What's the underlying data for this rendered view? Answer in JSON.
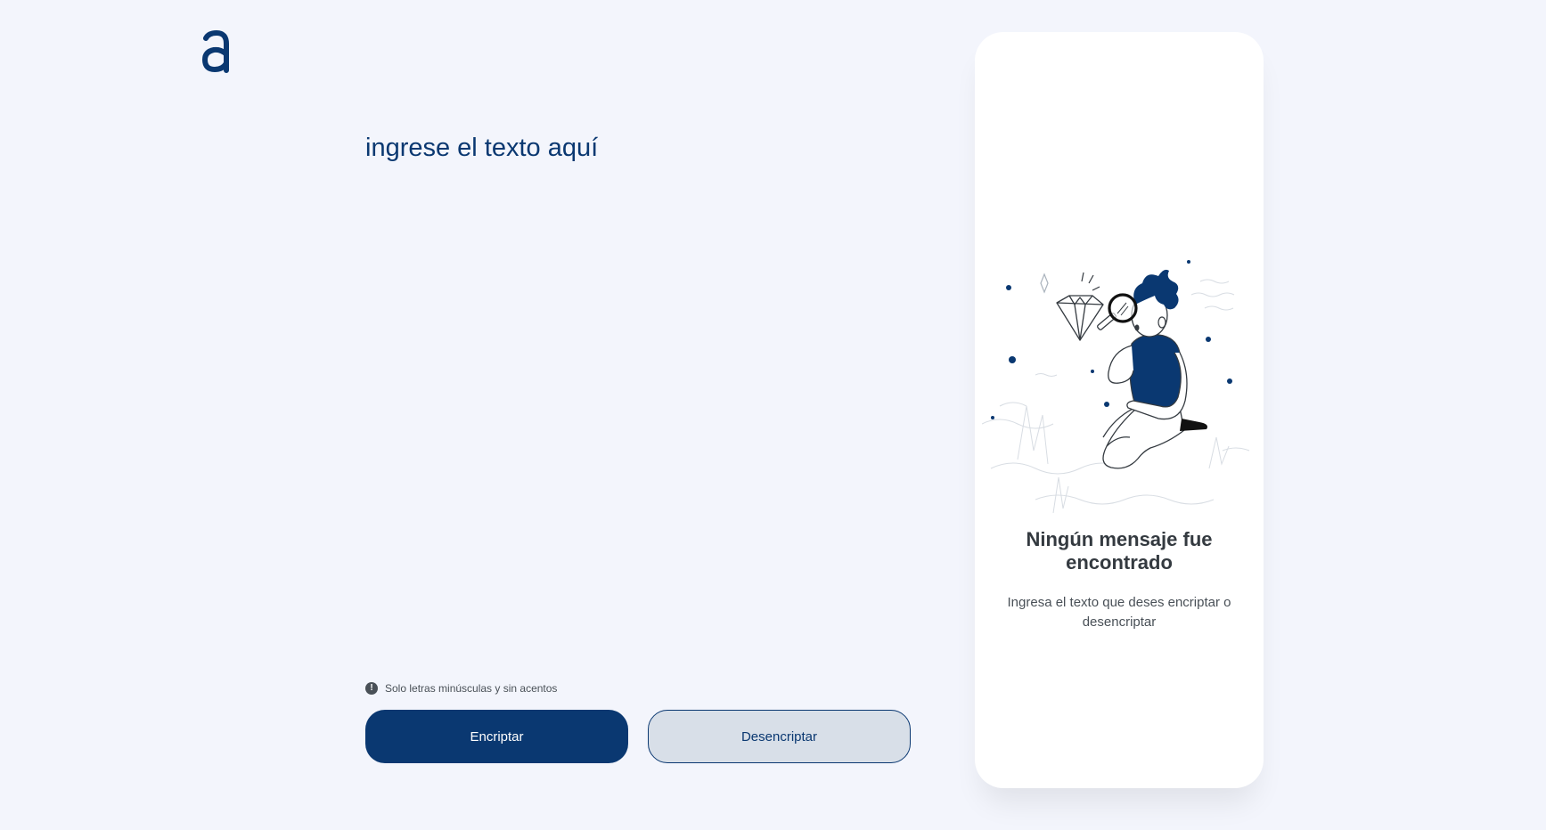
{
  "brand": {
    "logo_icon": "alura-a-logo-icon",
    "color": "#0a3871"
  },
  "input": {
    "placeholder": "ingrese el texto aquí",
    "value": ""
  },
  "hint": {
    "icon": "exclamation-circle-icon",
    "text": "Solo letras minúsculas y sin acentos"
  },
  "buttons": {
    "encrypt_label": "Encriptar",
    "decrypt_label": "Desencriptar"
  },
  "output_panel": {
    "illustration": "person-with-magnifying-glass-diamond-illustration",
    "empty_title": "Ningún mensaje fue encontrado",
    "empty_text": "Ingresa el texto que deses encriptar o desencriptar"
  },
  "colors": {
    "background": "#f3f5fc",
    "primary": "#0a3871",
    "secondary_button": "#d8dfe8",
    "panel": "#ffffff",
    "title_text": "#343a40",
    "body_text": "#495057"
  }
}
